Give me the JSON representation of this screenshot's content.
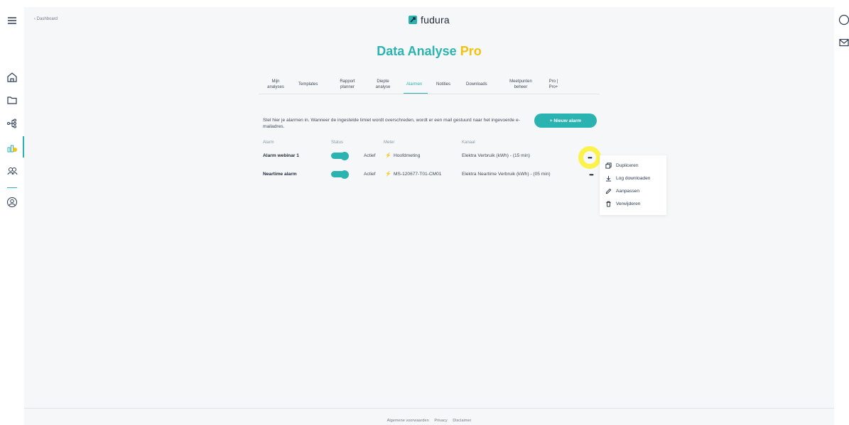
{
  "breadcrumb": "‹ Dashboard",
  "brand": {
    "name": "fudura",
    "logo_icon": "fudura-logo-icon"
  },
  "title": {
    "main": "Data Analyse",
    "accent": "Pro"
  },
  "tabs": [
    {
      "label": "Mijn analyses",
      "active": false
    },
    {
      "label": "Templates",
      "active": false
    },
    {
      "label": "Rapport planner",
      "active": false
    },
    {
      "label": "Diepte analyse",
      "active": false
    },
    {
      "label": "Alarmen",
      "active": true
    },
    {
      "label": "Notities",
      "active": false
    },
    {
      "label": "Downloads",
      "active": false
    },
    {
      "label": "Meetpunten beheer",
      "active": false
    },
    {
      "label": "Pro | Pro+",
      "active": false
    }
  ],
  "intro": "Stel hier je alarmen in. Wanneer de ingestelde limiet wordt overschreden, wordt er een mail gestuurd naar het ingevoerde e-mailadres.",
  "new_alarm_button": "+ Nieuw alarm",
  "table": {
    "headers": {
      "alarm": "Alarm",
      "status": "Status",
      "meter": "Meter",
      "kanaal": "Kanaal"
    },
    "rows": [
      {
        "alarm": "Alarm webinar 1",
        "status": "Actief",
        "meter": "Hoofdmeting",
        "kanaal": "Elektra Verbruik (kWh) - (15 min)",
        "enabled": true
      },
      {
        "alarm": "Neartime alarm",
        "status": "Actief",
        "meter": "MS-120677-T01-CM01",
        "kanaal": "Elektra Neartime Verbruik (kWh) - (05 min)",
        "enabled": true
      }
    ]
  },
  "more_label": "•••",
  "menu": {
    "items": [
      {
        "label": "Dupliceren",
        "icon": "duplicate-icon"
      },
      {
        "label": "Log downloaden",
        "icon": "download-icon"
      },
      {
        "label": "Aanpassen",
        "icon": "pencil-icon"
      },
      {
        "label": "Verwijderen",
        "icon": "trash-icon"
      }
    ]
  },
  "footer": {
    "terms": "Algemene voorwaarden",
    "privacy": "Privacy",
    "disclaimer": "Disclaimer"
  },
  "colors": {
    "accent": "#2bb3b1",
    "pro": "#f4c20d",
    "highlight": "#fbf34a",
    "background": "#f6f7f8"
  }
}
